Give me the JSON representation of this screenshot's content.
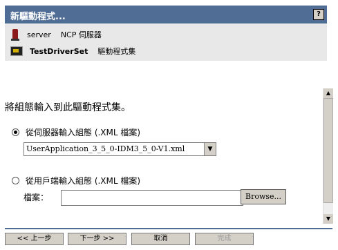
{
  "header": {
    "title": "新驅動程式...",
    "help_label": "?"
  },
  "info": {
    "server_name": "server",
    "server_type": "NCP 伺服器",
    "driverset_name": "TestDriverSet",
    "driverset_type": "驅動程式集"
  },
  "main": {
    "heading": "將組態輸入到此驅動程式集。",
    "option_server": {
      "label": "從伺服器輸入組態 (.XML 檔案)",
      "checked": true,
      "selected_file": "UserApplication_3_5_0-IDM3_5_0-V1.xml"
    },
    "option_client": {
      "label": "從用戶端輸入組態 (.XML 檔案)",
      "checked": false,
      "file_label": "檔案：",
      "file_value": "",
      "browse_label": "Browse..."
    }
  },
  "buttons": {
    "back": "<< 上一步",
    "next": "下一步 >>",
    "cancel": "取消",
    "finish": "完成"
  },
  "colors": {
    "header_bg": "#4f6d95",
    "info_bg": "#e8e8e8",
    "button_bg": "#d4d0c8"
  }
}
